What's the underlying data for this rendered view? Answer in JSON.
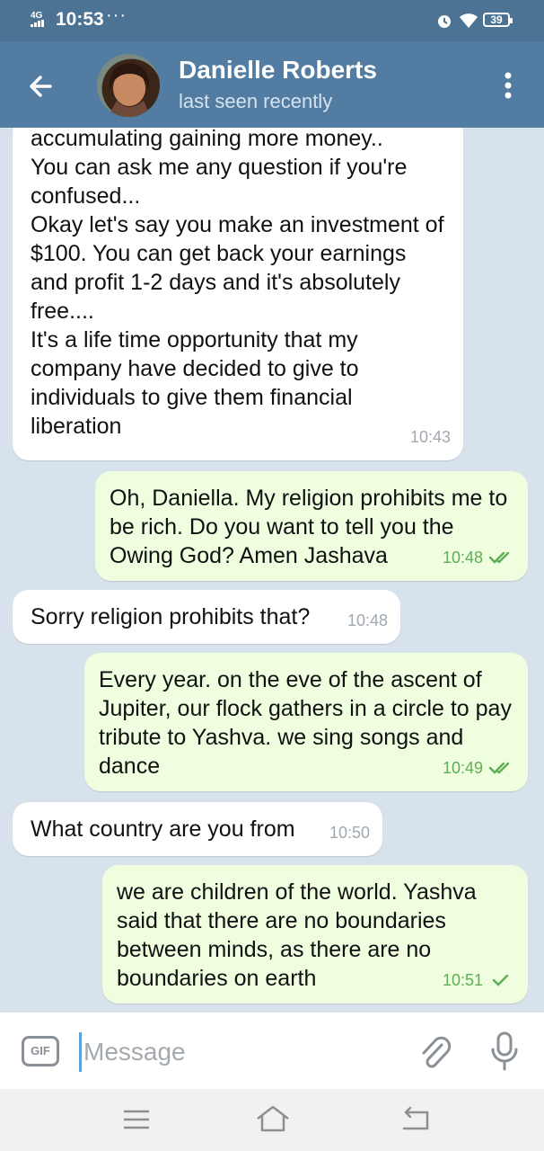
{
  "status_bar": {
    "network": "4G",
    "time": "10:53",
    "more": "···",
    "battery": "39"
  },
  "header": {
    "contact_name": "Danielle Roberts",
    "status": "last seen recently"
  },
  "messages": [
    {
      "direction": "in",
      "text": "accumulating gaining more money..\nYou can ask me any question if you're confused...\nOkay let's say you make an investment of $100. You can get back your earnings and profit 1-2 days and it's absolutely free....\nIt's a life time opportunity that my company have decided to give to individuals to give them financial liberation",
      "time": "10:43"
    },
    {
      "direction": "out",
      "text": "Oh, Daniella. My religion prohibits me to be rich. Do you want to tell you the Owing God? Amen Jashava",
      "time": "10:48",
      "status": "read"
    },
    {
      "direction": "in",
      "text": "Sorry religion prohibits that?",
      "time": "10:48"
    },
    {
      "direction": "out",
      "text": "Every year.  on the eve of the ascent of Jupiter, our flock gathers in a circle to pay tribute to Yashva.  we sing songs and dance",
      "time": "10:49",
      "status": "read"
    },
    {
      "direction": "in",
      "text": "What country are you from",
      "time": "10:50"
    },
    {
      "direction": "out",
      "text": "we are children of the world.  Yashva said that there are no boundaries between minds, as there are no boundaries on earth",
      "time": "10:51",
      "status": "sent"
    }
  ],
  "input_bar": {
    "gif_label": "GIF",
    "placeholder": "Message"
  },
  "colors": {
    "header": "#527ca1",
    "status_bar": "#4d7394",
    "outgoing_bubble": "#eefedf",
    "incoming_bubble": "#ffffff",
    "chat_background": "#d7e2ec"
  },
  "icons": {
    "back": "arrow-left-icon",
    "menu": "more-vertical-icon",
    "attach": "paperclip-icon",
    "mic": "microphone-icon"
  }
}
